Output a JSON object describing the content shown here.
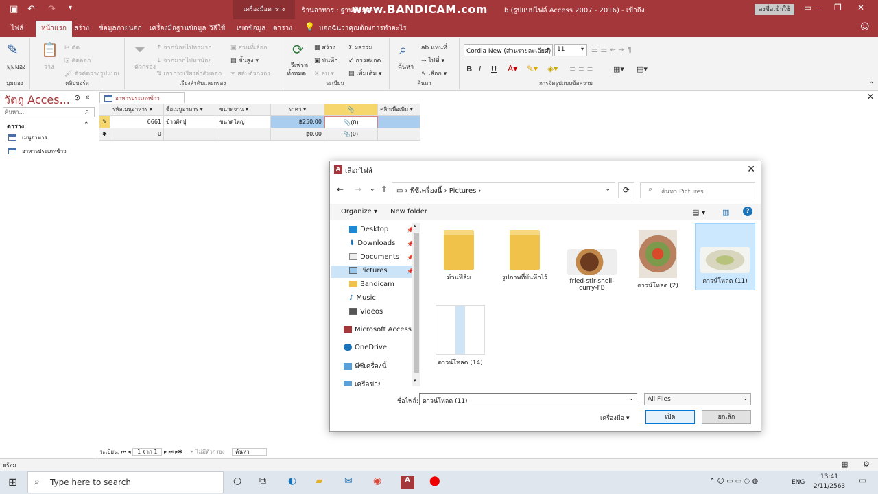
{
  "titlebar": {
    "context_tool": "เครื่องมือตาราง",
    "window_title": "ร้านอาหาร : ฐานข้อมูล- C:",
    "window_title_suffix": "b (รูปแบบไฟล์ Access 2007 - 2016)  -  เข้าถึง",
    "watermark": "www.BANDICAM.com",
    "signin": "ลงชื่อเข้าใช้"
  },
  "tabs": [
    "ไฟล์",
    "หน้าแรก",
    "สร้าง",
    "ข้อมูลภายนอก",
    "เครื่องมือฐานข้อมูล",
    "วิธีใช้",
    "เขตข้อมูล",
    "ตาราง"
  ],
  "tellme": "บอกฉันว่าคุณต้องการทำอะไร",
  "ribbon": {
    "views": {
      "label": "มุมมอง",
      "btn": "มุมมอง"
    },
    "clipboard": {
      "label": "คลิปบอร์ด",
      "paste": "วาง",
      "cut": "ตัด",
      "copy": "คัดลอก",
      "format": "ตัวคัดวางรูปแบบ"
    },
    "sort": {
      "label": "เรียงลำดับและกรอง",
      "filter": "ตัวกรอง",
      "asc": "จากน้อยไปหามาก",
      "desc": "จากมากไปหาน้อย",
      "remove": "เอาการเรียงลำดับออก",
      "selection": "ส่วนที่เลือก",
      "advanced": "ขั้นสูง",
      "toggle": "สลับตัวกรอง"
    },
    "records": {
      "label": "ระเบียน",
      "refresh": "รีเฟรช",
      "refresh2": "ทั้งหมด",
      "new": "สร้าง",
      "save": "บันทึก",
      "delete": "ลบ",
      "totals": "ผลรวม",
      "spelling": "การสะกด",
      "more": "เพิ่มเติม"
    },
    "find": {
      "label": "ค้นหา",
      "find": "ค้นหา",
      "replace": "แทนที่",
      "goto": "ไปที่",
      "select": "เลือก"
    },
    "textfmt": {
      "label": "การจัดรูปแบบข้อความ",
      "font": "Cordia New (ส่วนรายละเอียด)",
      "size": "11"
    }
  },
  "nav": {
    "title": "วัตถุ Acces...",
    "search_placeholder": "ค้นหา...",
    "group": "ตาราง",
    "items": [
      "เมนูอาหาร",
      "อาหารประเภทข้าว"
    ]
  },
  "doc": {
    "tab": "อาหารประเภทข้าว",
    "columns": [
      "รหัสเมนูอาหาร",
      "ชื่อเมนูอาหาร",
      "ขนาดจาน",
      "ราคา",
      "@",
      "คลิกเพื่อเพิ่ม"
    ],
    "rows": [
      [
        "6661",
        "ข้าวผัดปู",
        "ขนาดใหญ่",
        "฿250.00",
        "(0)",
        ""
      ],
      [
        "0",
        "",
        "",
        "฿0.00",
        "(0)",
        ""
      ]
    ],
    "recnav": {
      "label": "ระเบียน:",
      "pos": "1 จาก 1",
      "nofilter": "ไม่มีตัวกรอง",
      "search": "ค้นหา"
    }
  },
  "status": {
    "text": "พร้อม"
  },
  "taskbar": {
    "search": "Type here to search",
    "lang": "ENG",
    "time": "13:41",
    "date": "2/11/2563"
  },
  "dialog": {
    "title": "เลือกไฟล์",
    "path": [
      "พีซีเครื่องนี้",
      "Pictures"
    ],
    "search_placeholder": "ค้นหา Pictures",
    "organize": "Organize",
    "new_folder": "New folder",
    "tree": [
      "Desktop",
      "Downloads",
      "Documents",
      "Pictures",
      "Bandicam",
      "Music",
      "Videos",
      "Microsoft Access",
      "OneDrive",
      "พีซีเครื่องนี้",
      "เครือข่าย"
    ],
    "files": [
      {
        "name": "ม้วนฟิล์ม",
        "kind": "folder"
      },
      {
        "name": "รูปภาพที่บันทึกไว้",
        "kind": "folder"
      },
      {
        "name": "fried-stir-shell-curry-FB",
        "kind": "photo"
      },
      {
        "name": "ดาวน์โหลด (2)",
        "kind": "photo"
      },
      {
        "name": "ดาวน์โหลด (11)",
        "kind": "photo"
      },
      {
        "name": "ดาวน์โหลด (14)",
        "kind": "photo"
      }
    ],
    "filename_label": "ชื่อไฟล์:",
    "filename_value": "ดาวน์โหลด (11)",
    "filetype": "All Files",
    "tools": "เครื่องมือ",
    "open": "เปิด",
    "cancel": "ยกเลิก"
  },
  "colors": {
    "accent": "#a4373a",
    "select": "#cce8ff"
  }
}
